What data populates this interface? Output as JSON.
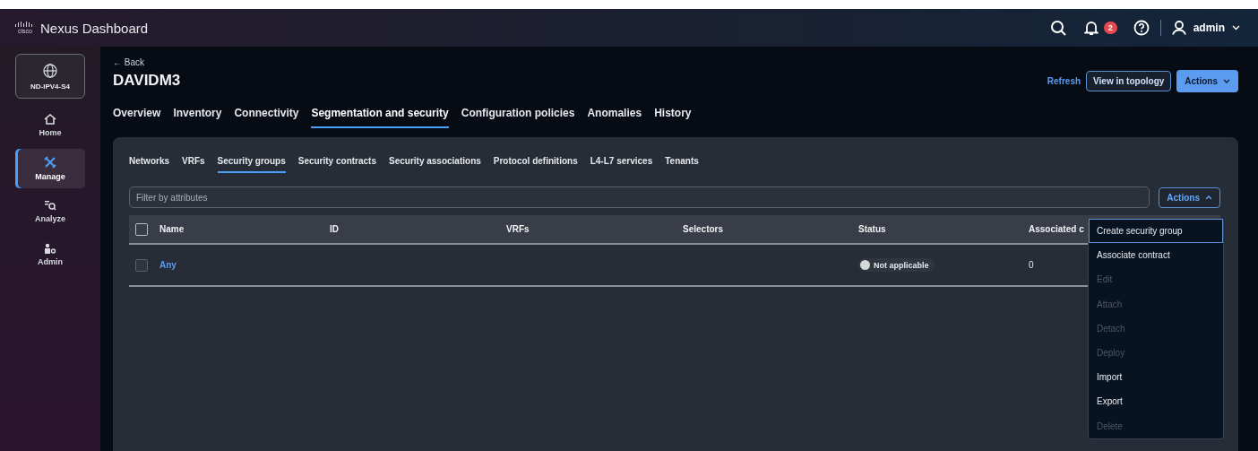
{
  "header": {
    "logo_text": "cisco",
    "title": "Nexus Dashboard",
    "notifications": "2",
    "user": "admin"
  },
  "sidebar": {
    "site": "ND-IPV4-S4",
    "items": [
      {
        "kind": "home",
        "label": "Home",
        "selected": false
      },
      {
        "kind": "manage",
        "label": "Manage",
        "selected": true
      },
      {
        "kind": "analyze",
        "label": "Analyze",
        "selected": false
      },
      {
        "kind": "admin",
        "label": "Admin",
        "selected": false
      }
    ]
  },
  "page": {
    "back": "← Back",
    "title": "DAVIDM3",
    "refresh": "Refresh",
    "view_topology": "View in topology",
    "actions": "Actions"
  },
  "tabs": [
    {
      "label": "Overview",
      "selected": false
    },
    {
      "label": "Inventory",
      "selected": false
    },
    {
      "label": "Connectivity",
      "selected": false
    },
    {
      "label": "Segmentation and security",
      "selected": true
    },
    {
      "label": "Configuration policies",
      "selected": false
    },
    {
      "label": "Anomalies",
      "selected": false
    },
    {
      "label": "History",
      "selected": false
    }
  ],
  "subtabs": [
    {
      "label": "Networks",
      "selected": false
    },
    {
      "label": "VRFs",
      "selected": false
    },
    {
      "label": "Security groups",
      "selected": true
    },
    {
      "label": "Security contracts",
      "selected": false
    },
    {
      "label": "Security associations",
      "selected": false
    },
    {
      "label": "Protocol definitions",
      "selected": false
    },
    {
      "label": "L4-L7 services",
      "selected": false
    },
    {
      "label": "Tenants",
      "selected": false
    }
  ],
  "filter": {
    "placeholder": "Filter by attributes"
  },
  "table_actions": {
    "label": "Actions",
    "expanded": true
  },
  "table": {
    "select_all": false,
    "columns": [
      "Name",
      "ID",
      "VRFs",
      "Selectors",
      "Status",
      "Associated c"
    ],
    "rows": [
      {
        "checked": false,
        "name": "Any",
        "id": "",
        "vrfs": "",
        "selectors": "",
        "status": "Not applicable",
        "associated": "0"
      }
    ]
  },
  "menu": [
    {
      "label": "Create security group",
      "selected": true,
      "disabled": false
    },
    {
      "label": "Associate contract",
      "selected": false,
      "disabled": false
    },
    {
      "label": "Edit",
      "selected": false,
      "disabled": true
    },
    {
      "label": "Attach",
      "selected": false,
      "disabled": true
    },
    {
      "label": "Detach",
      "selected": false,
      "disabled": true
    },
    {
      "label": "Deploy",
      "selected": false,
      "disabled": true
    },
    {
      "label": "Import",
      "selected": false,
      "disabled": false
    },
    {
      "label": "Export",
      "selected": false,
      "disabled": false
    },
    {
      "label": "Delete",
      "selected": false,
      "disabled": true
    }
  ]
}
